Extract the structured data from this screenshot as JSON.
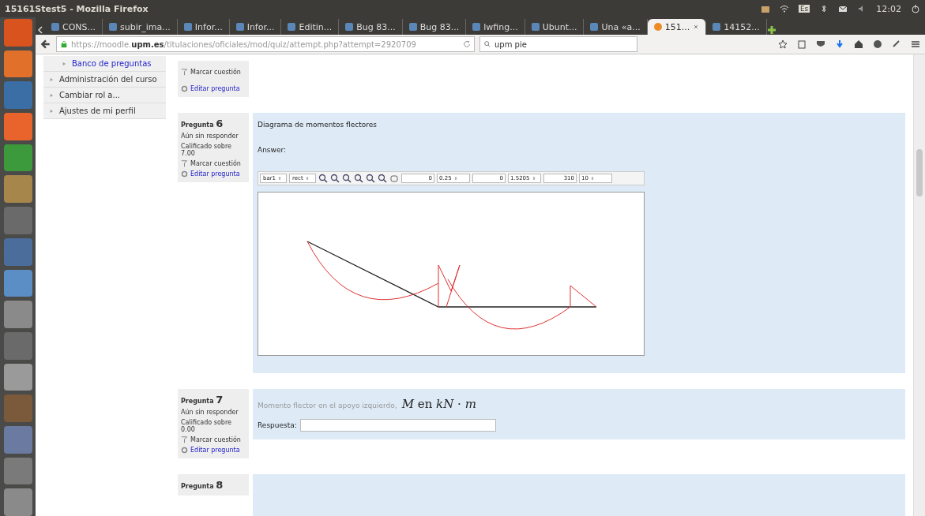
{
  "window": {
    "title": "15161Stest5 - Mozilla Firefox"
  },
  "panel": {
    "keyboard": "Es",
    "clock": "12:02"
  },
  "tabs": [
    {
      "label": "CONS...",
      "selected": false
    },
    {
      "label": "subir_ima...",
      "selected": false
    },
    {
      "label": "Infor...",
      "selected": false
    },
    {
      "label": "Infor...",
      "selected": false
    },
    {
      "label": "Editin...",
      "selected": false
    },
    {
      "label": "Bug 83...",
      "selected": false
    },
    {
      "label": "Bug 83...",
      "selected": false
    },
    {
      "label": "lwfing...",
      "selected": false
    },
    {
      "label": "Ubunt...",
      "selected": false
    },
    {
      "label": "Una «a...",
      "selected": false
    },
    {
      "label": "151...",
      "selected": true
    },
    {
      "label": "14152...",
      "selected": false
    }
  ],
  "navbar": {
    "url_prefix": "https://moodle.",
    "url_domain": "upm.es",
    "url_path": "/titulaciones/oficiales/mod/quiz/attempt.php?attempt=2920709",
    "search": "upm pie"
  },
  "sidebar": {
    "items": [
      {
        "label": "Banco de preguntas",
        "kind": "link"
      },
      {
        "label": "Administración del curso",
        "kind": "node"
      },
      {
        "label": "Cambiar rol a...",
        "kind": "node"
      },
      {
        "label": "Ajustes de mi perfil",
        "kind": "node"
      }
    ]
  },
  "questions": [
    {
      "kind": "tail",
      "flag": "Marcar cuestión",
      "edit": "Editar pregunta"
    },
    {
      "kind": "drawing",
      "label": "Pregunta",
      "number": "6",
      "state": "Aún sin responder",
      "grade": "Calificado sobre 7.00",
      "flag": "Marcar cuestión",
      "edit": "Editar pregunta",
      "text": "Diagrama de momentos flectores",
      "answer_label": "Answer:",
      "toolbar": {
        "selects": [
          "bar1",
          "rect"
        ],
        "pairs": [
          [
            "0",
            "0.25"
          ],
          [
            "0",
            "1.5205"
          ],
          [
            "310",
            "10"
          ]
        ]
      }
    },
    {
      "kind": "numeric",
      "label": "Pregunta",
      "number": "7",
      "state": "Aún sin responder",
      "grade": "Calificado sobre 0.00",
      "flag": "Marcar cuestión",
      "edit": "Editar pregunta",
      "prompt": "Momento flector en el apoyo izquierdo,",
      "formula": "*M* en *kN* · *m*",
      "answer_label": "Respuesta:"
    },
    {
      "kind": "head",
      "label": "Pregunta",
      "number": "8"
    }
  ]
}
